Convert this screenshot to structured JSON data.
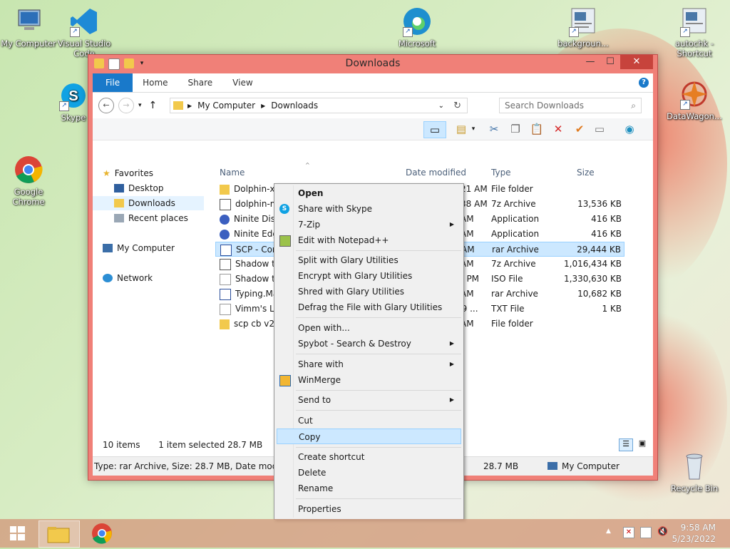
{
  "desktop": {
    "icons": [
      {
        "label": "My Computer"
      },
      {
        "label": "Visual Studio Code"
      },
      {
        "label": "Skype"
      },
      {
        "label": "Google Chrome"
      },
      {
        "label": "Microsoft"
      },
      {
        "label": "backgroun..."
      },
      {
        "label": "autochk - Shortcut"
      },
      {
        "label": "DataWagon..."
      },
      {
        "label": "Recycle Bin"
      }
    ]
  },
  "window": {
    "title": "Downloads",
    "tabs": [
      "File",
      "Home",
      "Share",
      "View"
    ],
    "address": [
      "My Computer",
      "Downloads"
    ],
    "search_placeholder": "Search Downloads"
  },
  "nav": {
    "favorites": "Favorites",
    "desktop": "Desktop",
    "downloads": "Downloads",
    "recent": "Recent places",
    "computer": "My Computer",
    "network": "Network"
  },
  "columns": {
    "name": "Name",
    "date": "Date modified",
    "type": "Type",
    "size": "Size"
  },
  "files": [
    {
      "name": "Dolphin-x64",
      "date": "5/6/2022 12:21 AM",
      "type": "File folder",
      "size": ""
    },
    {
      "name": "dolphin-m...5.0-16380-x64",
      "date": "5/23/2022 9:38 AM",
      "type": "7z Archive",
      "size": "13,536 KB"
    },
    {
      "name": "Ninite Disc",
      "date": "AM",
      "type": "Application",
      "size": "416 KB"
    },
    {
      "name": "Ninite Edg",
      "date": "AM",
      "type": "Application",
      "size": "416 KB"
    },
    {
      "name": "SCP - Con",
      "date": "AM",
      "type": "rar Archive",
      "size": "29,444 KB"
    },
    {
      "name": "Shadow th",
      "date": "AM",
      "type": "7z Archive",
      "size": "1,016,434 KB"
    },
    {
      "name": "Shadow th",
      "date": "5 PM",
      "type": "ISO File",
      "size": "1,330,630 KB"
    },
    {
      "name": "Typing.Ma",
      "date": "AM",
      "type": "rar Archive",
      "size": "10,682 KB"
    },
    {
      "name": "Vimm's La",
      "date": "59 ...",
      "type": "TXT File",
      "size": "1 KB"
    },
    {
      "name": "scp cb v2.0",
      "date": "AM",
      "type": "File folder",
      "size": ""
    }
  ],
  "status": {
    "count": "10 items",
    "selected": "1 item selected  28.7 MB",
    "details": "Type: rar Archive, Size: 28.7 MB, Date modified:",
    "details_size": "28.7 MB",
    "details_location": "My Computer"
  },
  "context_menu": [
    {
      "label": "Open",
      "bold": true
    },
    {
      "label": "Share with Skype"
    },
    {
      "label": "7-Zip",
      "submenu": true
    },
    {
      "label": "Edit with Notepad++"
    },
    {
      "label": "Split with Glary Utilities"
    },
    {
      "label": "Encrypt with Glary Utilities"
    },
    {
      "label": "Shred with Glary Utilities"
    },
    {
      "label": "Defrag the File with Glary Utilities"
    },
    {
      "label": "Open with..."
    },
    {
      "label": "Spybot - Search & Destroy",
      "submenu": true
    },
    {
      "label": "Share with",
      "submenu": true
    },
    {
      "label": "WinMerge"
    },
    {
      "label": "Send to",
      "submenu": true
    },
    {
      "label": "Cut"
    },
    {
      "label": "Copy",
      "highlighted": true
    },
    {
      "label": "Create shortcut"
    },
    {
      "label": "Delete"
    },
    {
      "label": "Rename"
    },
    {
      "label": "Properties"
    }
  ],
  "taskbar": {
    "time": "9:58 AM",
    "date": "5/23/2022"
  }
}
